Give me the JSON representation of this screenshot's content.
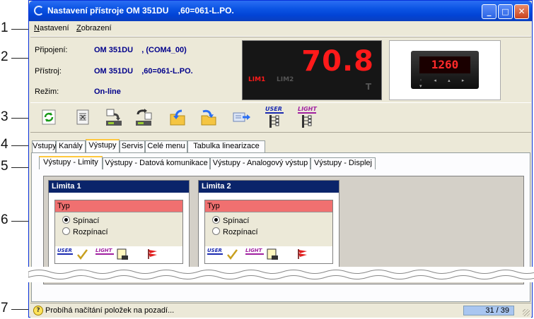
{
  "callouts": [
    "1",
    "2",
    "3",
    "4",
    "5",
    "6",
    "7"
  ],
  "window": {
    "title": "Nastavení přístroje OM 351DU    ,60=061-L.PO.",
    "controls": {
      "minimize": "_",
      "maximize": "□",
      "close": "✕"
    }
  },
  "menu": {
    "items": [
      {
        "accel": "N",
        "rest": "astavení"
      },
      {
        "accel": "Z",
        "rest": "obrazení"
      }
    ]
  },
  "info": {
    "connection_label": "Připojení:",
    "connection_value": "OM 351DU    , (COM4_00)",
    "device_label": "Přístroj:",
    "device_value": "OM 351DU    ,60=061-L.PO.",
    "mode_label": "Režim:",
    "mode_value": "On-line"
  },
  "display": {
    "value": "70.8",
    "lim1": "LIM1",
    "lim2": "LIM2",
    "indicator": "T",
    "colors": {
      "active": "#ff1a1a",
      "inactive": "#555555"
    }
  },
  "device_photo": {
    "screen_value": "1260",
    "buttons": "◦ ◂ ▴ ▸ ▾"
  },
  "toolbar": {
    "buttons": [
      "refresh-icon",
      "compare-icon",
      "read-device-icon",
      "write-device-icon",
      "open-file-icon",
      "save-file-icon",
      "export-icon",
      "user-menu-icon",
      "light-menu-icon"
    ],
    "user_label": "USER",
    "light_label": "LIGHT"
  },
  "tabs": [
    "Vstupy",
    "Kanály",
    "Výstupy",
    "Servis",
    "Celé menu",
    "Tabulka linearizace"
  ],
  "active_tab": "Výstupy",
  "subtabs": [
    "Výstupy - Limity",
    "Výstupy - Datová komunikace",
    "Výstupy - Analogový výstup",
    "Výstupy - Displej"
  ],
  "active_subtab": "Výstupy - Limity",
  "cards": [
    {
      "title": "Limita 1",
      "type_label": "Typ",
      "options": [
        "Spínací",
        "Rozpínací"
      ],
      "selected": "Spínací",
      "user_label": "USER",
      "light_label": "LIGHT"
    },
    {
      "title": "Limita 2",
      "type_label": "Typ",
      "options": [
        "Spínací",
        "Rozpínací"
      ],
      "selected": "Spínací",
      "user_label": "USER",
      "light_label": "LIGHT"
    }
  ],
  "status": {
    "text": "Probíhá načítání položek na pozadí...",
    "count": "31 / 39"
  }
}
